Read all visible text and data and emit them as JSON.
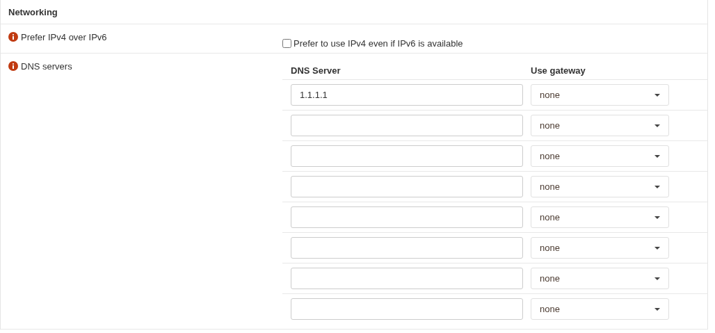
{
  "section": {
    "title": "Networking"
  },
  "prefer_ipv4": {
    "label": "Prefer IPv4 over IPv6",
    "checkbox_label": "Prefer to use IPv4 even if IPv6 is available",
    "checked": false
  },
  "dns_servers": {
    "label": "DNS servers",
    "columns": [
      "DNS Server",
      "Use gateway"
    ],
    "rows": [
      {
        "server": "1.1.1.1",
        "gateway": "none"
      },
      {
        "server": "",
        "gateway": "none"
      },
      {
        "server": "",
        "gateway": "none"
      },
      {
        "server": "",
        "gateway": "none"
      },
      {
        "server": "",
        "gateway": "none"
      },
      {
        "server": "",
        "gateway": "none"
      },
      {
        "server": "",
        "gateway": "none"
      },
      {
        "server": "",
        "gateway": "none"
      }
    ]
  }
}
